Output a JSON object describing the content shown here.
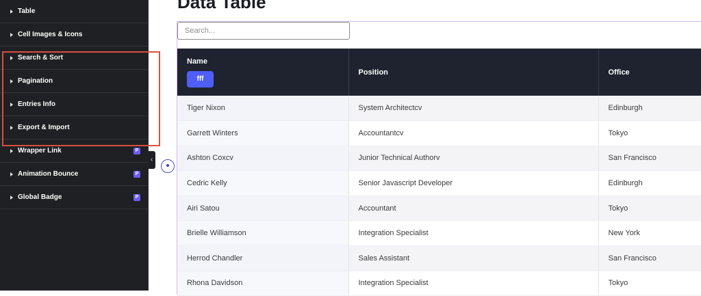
{
  "sidebar": {
    "items": [
      {
        "label": "Table",
        "pro": false
      },
      {
        "label": "Cell Images & Icons",
        "pro": false
      },
      {
        "label": "Search & Sort",
        "pro": false
      },
      {
        "label": "Pagination",
        "pro": false
      },
      {
        "label": "Entries Info",
        "pro": false
      },
      {
        "label": "Export & Import",
        "pro": false
      },
      {
        "label": "Wrapper Link",
        "pro": true
      },
      {
        "label": "Animation Bounce",
        "pro": true
      },
      {
        "label": "Global Badge",
        "pro": true
      }
    ],
    "collapse_glyph": "‹",
    "pro_glyph": "P"
  },
  "page": {
    "title": "Data Table"
  },
  "search": {
    "placeholder": "Search..."
  },
  "table": {
    "headers": {
      "name": "Name",
      "name_button": "fff",
      "position": "Position",
      "office": "Office"
    },
    "rows": [
      {
        "name": "Tiger Nixon",
        "position": "System Architectcv",
        "office": "Edinburgh"
      },
      {
        "name": "Garrett Winters",
        "position": "Accountantcv",
        "office": "Tokyo"
      },
      {
        "name": "Ashton Coxcv",
        "position": "Junior Technical Authorv",
        "office": "San Francisco"
      },
      {
        "name": "Cedric Kelly",
        "position": "Senior Javascript Developer",
        "office": "Edinburgh"
      },
      {
        "name": "Airi Satou",
        "position": "Accountant",
        "office": "Tokyo"
      },
      {
        "name": "Brielle Williamson",
        "position": "Integration Specialist",
        "office": "New York"
      },
      {
        "name": "Herrod Chandler",
        "position": "Sales Assistant",
        "office": "San Francisco"
      },
      {
        "name": "Rhona Davidson",
        "position": "Integration Specialist",
        "office": "Tokyo"
      }
    ]
  },
  "colors": {
    "sidebar_bg": "#1f2023",
    "highlight": "#d8503e",
    "header_bg": "#1f2330",
    "button_accent": "#4e5ef6",
    "pro_badge": "#6d5dfc"
  }
}
